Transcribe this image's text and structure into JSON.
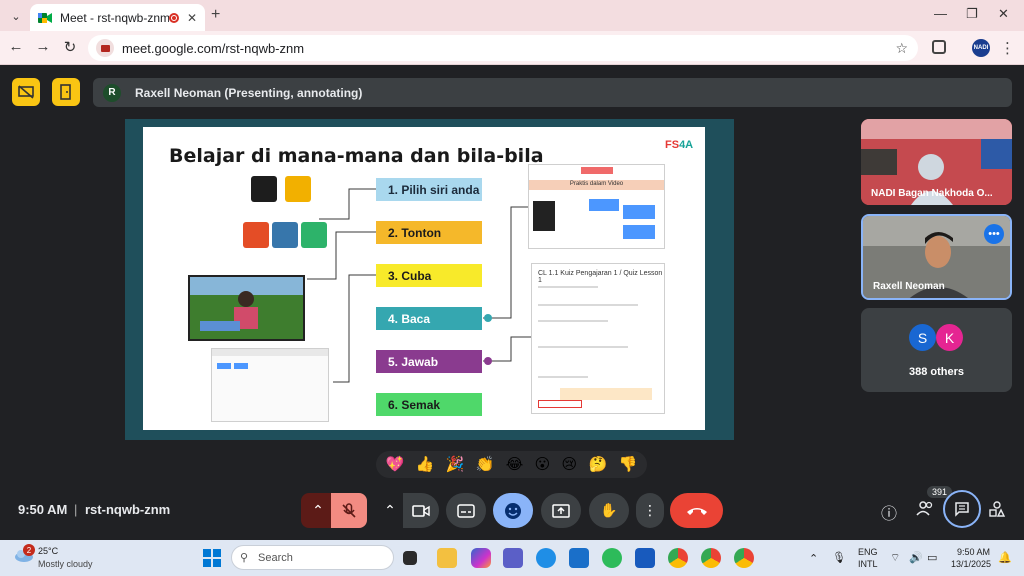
{
  "browser": {
    "tab_title": "Meet - rst-nqwb-znm",
    "url": "meet.google.com/rst-nqwb-znm",
    "profile_initials": "NADI"
  },
  "meet": {
    "presenter_initial": "R",
    "presenter_label": "Raxell Neoman (Presenting, annotating)",
    "time": "9:50 AM",
    "meeting_code": "rst-nqwb-znm",
    "people_count": "391"
  },
  "slide": {
    "title": "Belajar di mana-mana dan bila-bila",
    "logo_a": "FS",
    "logo_b": "4A",
    "steps": [
      {
        "label": "1. Pilih siri anda",
        "bg": "#a9d8ee",
        "fg": "#1b2a3a"
      },
      {
        "label": "2. Tonton",
        "bg": "#f5b82a",
        "fg": "#1b1b1b"
      },
      {
        "label": "3. Cuba",
        "bg": "#f8ea2a",
        "fg": "#1b1b1b"
      },
      {
        "label": "4. Baca",
        "bg": "#35a7b0",
        "fg": "#ffffff"
      },
      {
        "label": "5. Jawab",
        "bg": "#8a3b8f",
        "fg": "#ffffff"
      },
      {
        "label": "6. Semak",
        "bg": "#4fd86a",
        "fg": "#1b1b1b"
      }
    ],
    "quiz_title": "CL 1.1 Kuiz Pengajaran 1 / Quiz Lesson 1",
    "praktis_label": "Praktis dalam Video"
  },
  "participants": [
    {
      "name": "NADI Bagan Nakhoda O..."
    },
    {
      "name": "Raxell Neoman"
    },
    {
      "initials": [
        "S",
        "K"
      ],
      "others": "388 others"
    }
  ],
  "taskbar": {
    "temp": "25°C",
    "weather": "Mostly cloudy",
    "weather_badge": "2",
    "search_placeholder": "Search",
    "lang1": "ENG",
    "lang2": "INTL",
    "clock": "9:50 AM",
    "date": "13/1/2025"
  },
  "colors": {
    "accent_yellow": "#f9c513",
    "end_call": "#ea4335",
    "emoji_active": "#8ab4f8"
  }
}
